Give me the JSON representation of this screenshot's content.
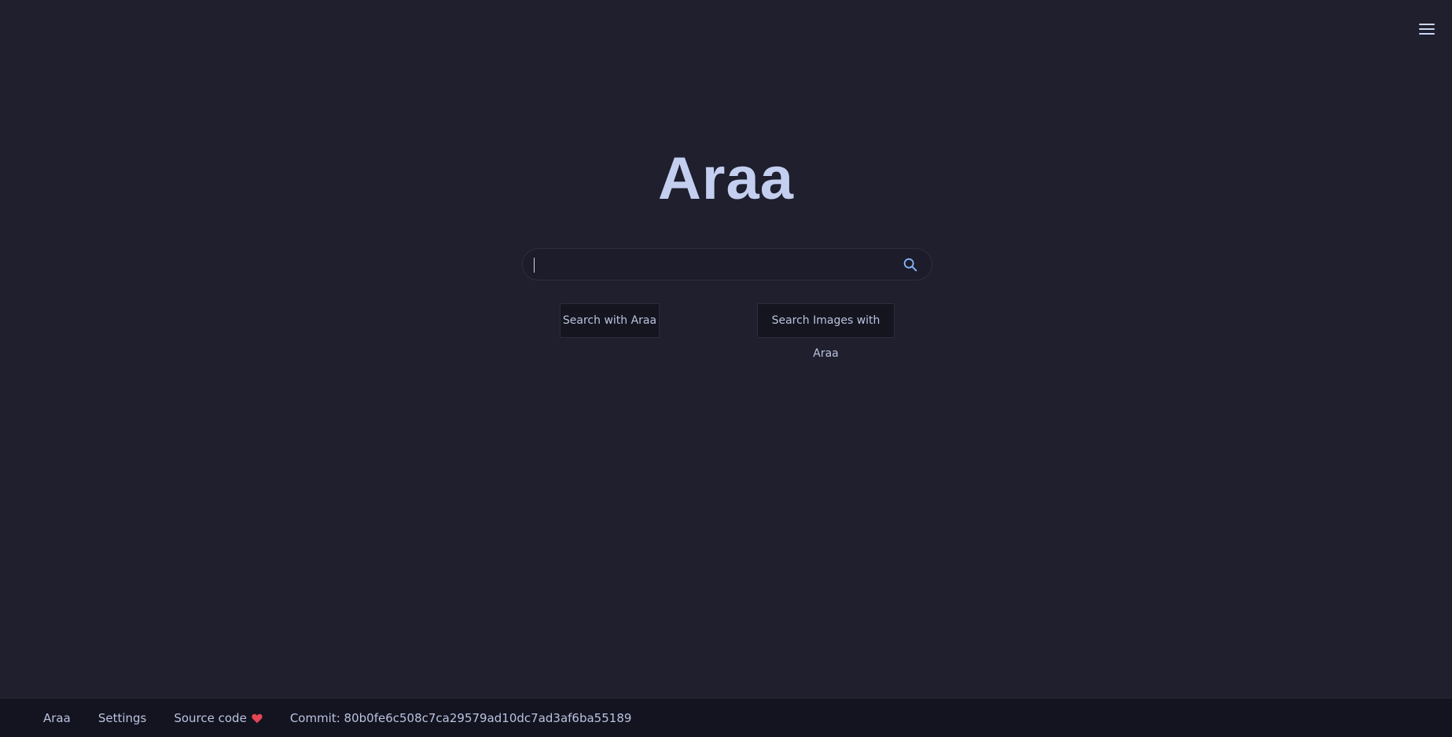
{
  "header": {
    "menu_icon": "hamburger-menu-icon"
  },
  "logo": {
    "text": "Araa"
  },
  "search": {
    "value": "",
    "placeholder": "",
    "icon": "search-icon",
    "icon_color": "#89b4fa"
  },
  "buttons": {
    "search_label": "Search with Araa",
    "images_label": "Search Images with Araa"
  },
  "footer": {
    "home_label": "Araa",
    "settings_label": "Settings",
    "source_label": "Source code",
    "heart_icon": "heart-icon",
    "heart_color": "#e64553",
    "commit_text": "Commit: 80b0fe6c508c7ca29579ad10dc7ad3af6ba55189"
  },
  "colors": {
    "background": "#1f1f2e",
    "logo": "#c4cff0",
    "text": "#bac2de"
  }
}
